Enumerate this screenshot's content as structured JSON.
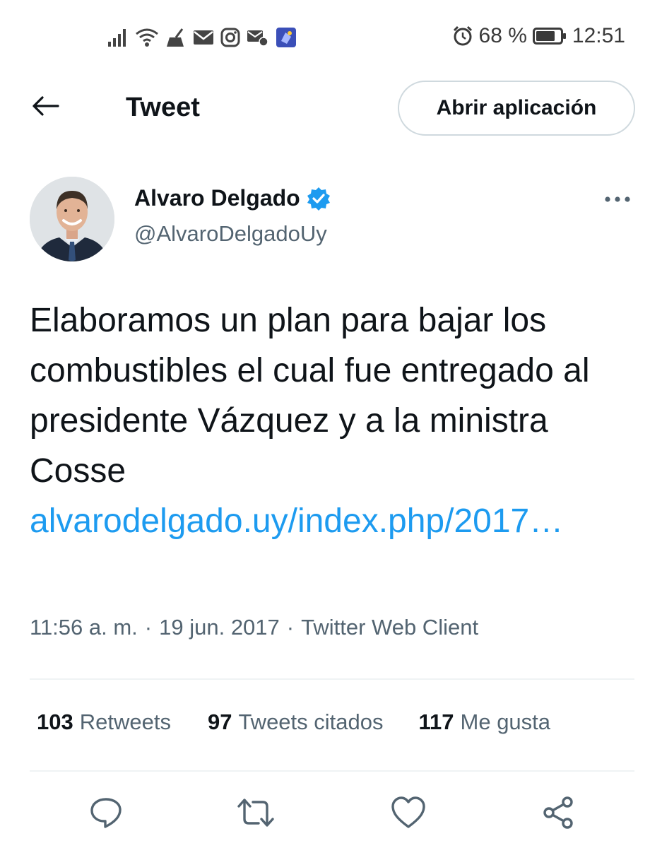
{
  "status_bar": {
    "battery_text": "68 %",
    "time": "12:51",
    "left_icons": [
      "signal-icon",
      "wifi-icon",
      "broom-icon",
      "mail-icon",
      "instagram-icon",
      "messenger-icon",
      "app-icon"
    ],
    "right_icons": [
      "alarm-icon",
      "battery-icon"
    ]
  },
  "header": {
    "title": "Tweet",
    "open_app_label": "Abrir aplicación",
    "back_icon": "back-arrow-icon"
  },
  "author": {
    "name": "Alvaro Delgado",
    "handle": "@AlvaroDelgadoUy",
    "verified_icon": "verified-badge-icon",
    "more_icon": "more-options-icon"
  },
  "tweet": {
    "text": "Elaboramos un plan para bajar los combustibles el cual fue entregado al presidente Vázquez y a la ministra Cosse",
    "link": "alvarodelgado.uy/index.php/2017…",
    "time": "11:56 a. m.",
    "separator": "·",
    "date": "19 jun. 2017",
    "client": "Twitter Web Client"
  },
  "stats": {
    "retweets_count": "103",
    "retweets_label": "Retweets",
    "quotes_count": "97",
    "quotes_label": "Tweets citados",
    "likes_count": "117",
    "likes_label": "Me gusta"
  },
  "actions": [
    "reply-icon",
    "retweet-icon",
    "like-icon",
    "share-icon"
  ],
  "colors": {
    "accent": "#1d9bf0",
    "text": "#0f1419",
    "secondary_text": "#536471",
    "divider": "#eff3f4"
  }
}
